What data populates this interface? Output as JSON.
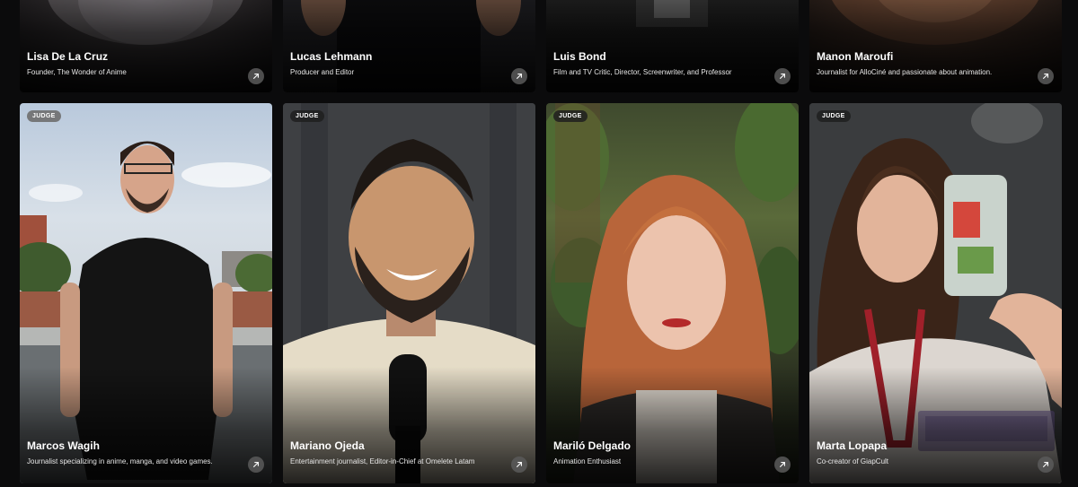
{
  "badge_label": "JUDGE",
  "top_row": [
    {
      "name": "Lisa De La Cruz",
      "role": "Founder, The Wonder of Anime"
    },
    {
      "name": "Lucas Lehmann",
      "role": "Producer and Editor"
    },
    {
      "name": "Luis Bond",
      "role": "Film and TV Critic, Director, Screenwriter, and Professor"
    },
    {
      "name": "Manon Maroufi",
      "role": "Journalist for AlloCiné and passionate about animation."
    }
  ],
  "bottom_row": [
    {
      "name": "Marcos Wagih",
      "role": "Journalist specializing in anime, manga, and video games."
    },
    {
      "name": "Mariano Ojeda",
      "role": "Entertainment journalist, Editor-in-Chief at Omelete Latam"
    },
    {
      "name": "Mariló Delgado",
      "role": "Animation Enthusiast"
    },
    {
      "name": "Marta Lopapa",
      "role": "Co-creator of GiapCult"
    }
  ],
  "icons": {
    "arrow": "arrow-up-right-icon"
  }
}
